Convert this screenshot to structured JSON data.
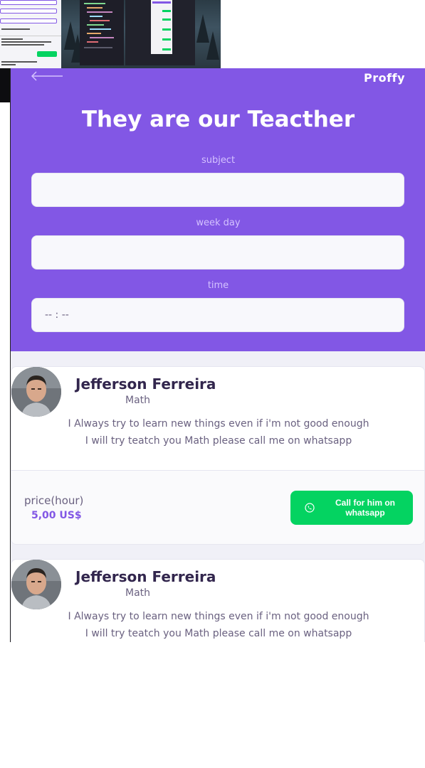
{
  "app": {
    "logo": "Proffy",
    "title": "They are our Teacther"
  },
  "filters": {
    "subject_label": "subject",
    "subject_value": "",
    "weekday_label": "week day",
    "weekday_value": "",
    "time_label": "time",
    "time_value": "-- : --"
  },
  "teachers": [
    {
      "name": "Jefferson Ferreira",
      "subject": "Math",
      "bio_line1": "I Always try to learn new things even if i'm not good enough",
      "bio_line2": "I will try teatch you Math please call me on whatsapp",
      "price_label": "price(hour)",
      "price_value": "5,00 US$",
      "button_label": "Call for him on whatsapp"
    },
    {
      "name": "Jefferson Ferreira",
      "subject": "Math",
      "bio_line1": "I Always try to learn new things even if i'm not good enough",
      "bio_line2": "I will try teatch you Math please call me on whatsapp"
    }
  ],
  "colors": {
    "primary": "#8257e5",
    "secondary": "#04d361",
    "background": "#f0f0f7",
    "title_text": "#32264d",
    "base_text": "#6a6180"
  },
  "icons": {
    "back": "arrow-left-icon",
    "whatsapp": "whatsapp-icon"
  }
}
